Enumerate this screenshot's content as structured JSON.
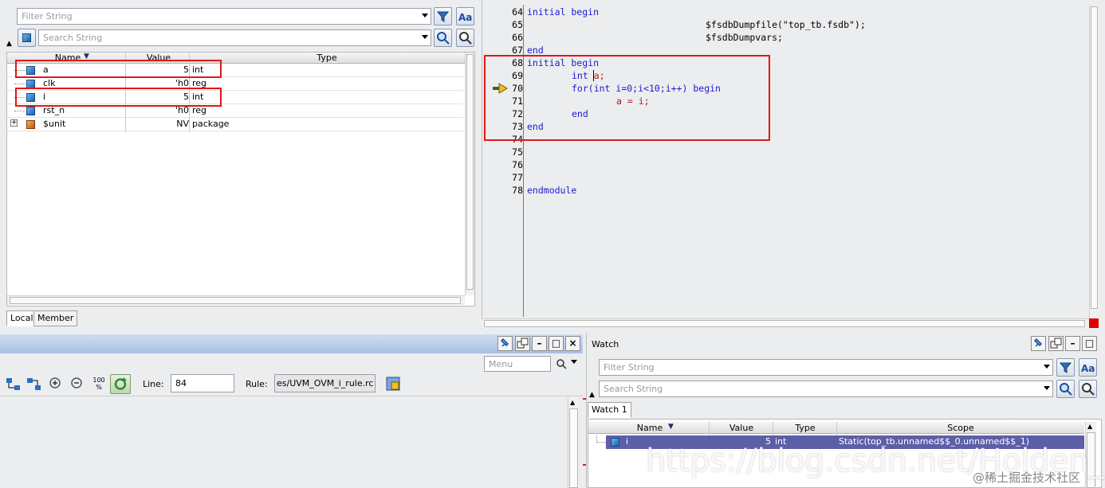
{
  "locals": {
    "filter_placeholder": "Filter String",
    "search_placeholder": "Search String",
    "columns": {
      "name": "Name",
      "value": "Value",
      "type": "Type"
    },
    "rows": [
      {
        "name": "a",
        "value": "5",
        "type": "int"
      },
      {
        "name": "clk",
        "value": "'h0",
        "type": "reg"
      },
      {
        "name": "i",
        "value": "5",
        "type": "int"
      },
      {
        "name": "rst_n",
        "value": "'h0",
        "type": "reg"
      },
      {
        "name": "$unit",
        "value": "NV",
        "type": "package"
      }
    ],
    "tabs": [
      "Local",
      "Member"
    ]
  },
  "source": {
    "lines": [
      {
        "num": "64",
        "text": "initial begin"
      },
      {
        "num": "65",
        "text": "$fsdbDumpfile(\"top_tb.fsdb\");"
      },
      {
        "num": "66",
        "text": "$fsdbDumpvars;"
      },
      {
        "num": "67",
        "text": "end"
      },
      {
        "num": "68",
        "text": "initial begin"
      },
      {
        "num": "69",
        "text_kw": "int",
        "text_rest": "a;"
      },
      {
        "num": "70",
        "text_kw": "for",
        "text_rest": "(int i=0;i<10;i++) ",
        "text_kw2": "begin"
      },
      {
        "num": "71",
        "text": "a = i;"
      },
      {
        "num": "72",
        "text": "end"
      },
      {
        "num": "73",
        "text": "end"
      },
      {
        "num": "74",
        "text": ""
      },
      {
        "num": "75",
        "text": ""
      },
      {
        "num": "76",
        "text": ""
      },
      {
        "num": "77",
        "text": ""
      },
      {
        "num": "78",
        "text": "endmodule"
      }
    ]
  },
  "toolbar": {
    "menu_placeholder": "Menu",
    "zoom_label": "100 %",
    "line_label": "Line:",
    "line_value": "84",
    "rule_label": "Rule:",
    "rule_value": "es/UVM_OVM_i_rule.rc"
  },
  "watch": {
    "title": "Watch",
    "filter_placeholder": "Filter String",
    "search_placeholder": "Search String",
    "tab": "Watch 1",
    "columns": {
      "name": "Name",
      "value": "Value",
      "type": "Type",
      "scope": "Scope"
    },
    "rows": [
      {
        "name": "i",
        "value": "5",
        "type": "int",
        "scope": "Static(top_tb.unnamed$$_0.unnamed$$_1)"
      }
    ]
  },
  "watermark": {
    "url": "https://blog.csdn.net/Holden_Liu",
    "credit": "@稀土掘金技术社区"
  },
  "colors": {
    "accent": "#5c5fa8",
    "highlight": "#e01818",
    "keyword": "#1c1ccc"
  }
}
